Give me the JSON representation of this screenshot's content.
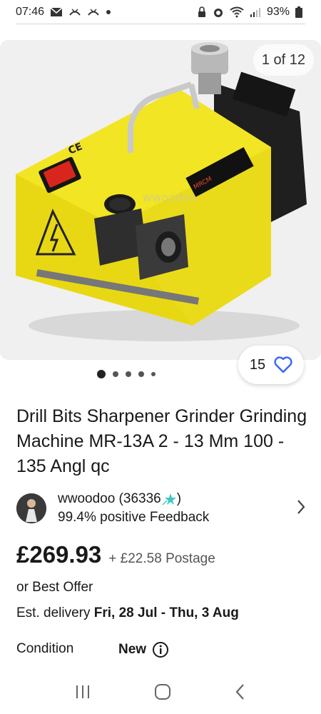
{
  "status_bar": {
    "time": "07:46",
    "battery": "93%",
    "left_icons": [
      "mail-icon",
      "missed-call-icon",
      "missed-call-icon",
      "dot-icon"
    ],
    "right_icons": [
      "lock-icon",
      "alarm-icon",
      "wifi-icon",
      "signal-icon",
      "battery-icon"
    ]
  },
  "gallery": {
    "counter": "1 of 12",
    "watch_count": "15",
    "dots": 5,
    "active_index": 0
  },
  "listing": {
    "title": "Drill Bits Sharpener Grinder Grinding Machine MR-13A 2 - 13 Mm 100 - 135 Angl qc",
    "seller_name": "wwoodoo (36336",
    "seller_name_suffix": ")",
    "seller_feedback": "99.4% positive Feedback",
    "price": "£269.93",
    "postage": "+ £22.58 Postage",
    "best_offer": "or Best Offer",
    "delivery_prefix": "Est. delivery ",
    "delivery_dates": "Fri, 28 Jul - Thu, 3 Aug",
    "condition_label": "Condition",
    "condition_value": "New"
  },
  "product_image": {
    "brand_label": "MRCM",
    "watermark": "wwoodoo"
  },
  "colors": {
    "accent_blue": "#3665f3",
    "machine_yellow": "#f2e524",
    "text": "#191919"
  }
}
